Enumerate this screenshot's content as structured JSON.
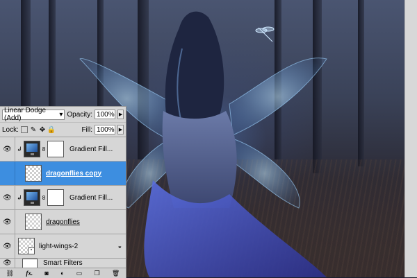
{
  "panel": {
    "blend_mode": "Linear Dodge (Add)",
    "opacity_label": "Opacity:",
    "opacity_value": "100%",
    "lock_label": "Lock:",
    "fill_label": "Fill:",
    "fill_value": "100%"
  },
  "layers": [
    {
      "name": "Gradient Fill...",
      "type": "gradient-fill",
      "clipped": true,
      "selected": false
    },
    {
      "name": "dragonflies copy",
      "type": "pixel",
      "clipped": false,
      "selected": true
    },
    {
      "name": "Gradient Fill...",
      "type": "gradient-fill",
      "clipped": true,
      "selected": false
    },
    {
      "name": "dragonflies",
      "type": "pixel",
      "clipped": false,
      "selected": false
    },
    {
      "name": "light-wings-2",
      "type": "smart-object",
      "clipped": false,
      "selected": false
    },
    {
      "name": "Smart Filters",
      "type": "smart-filters",
      "clipped": false,
      "selected": false
    }
  ],
  "icons": {
    "visibility": "eye-icon",
    "lock_transparent": "checker-lock-icon",
    "lock_paint": "brush-lock-icon",
    "lock_move": "move-lock-icon",
    "lock_all": "padlock-icon",
    "mask_link": "chain-icon",
    "clip": "clip-arrow-icon"
  },
  "colors": {
    "panel_bg": "#d6d6d6",
    "selection": "#3d8ee0"
  }
}
